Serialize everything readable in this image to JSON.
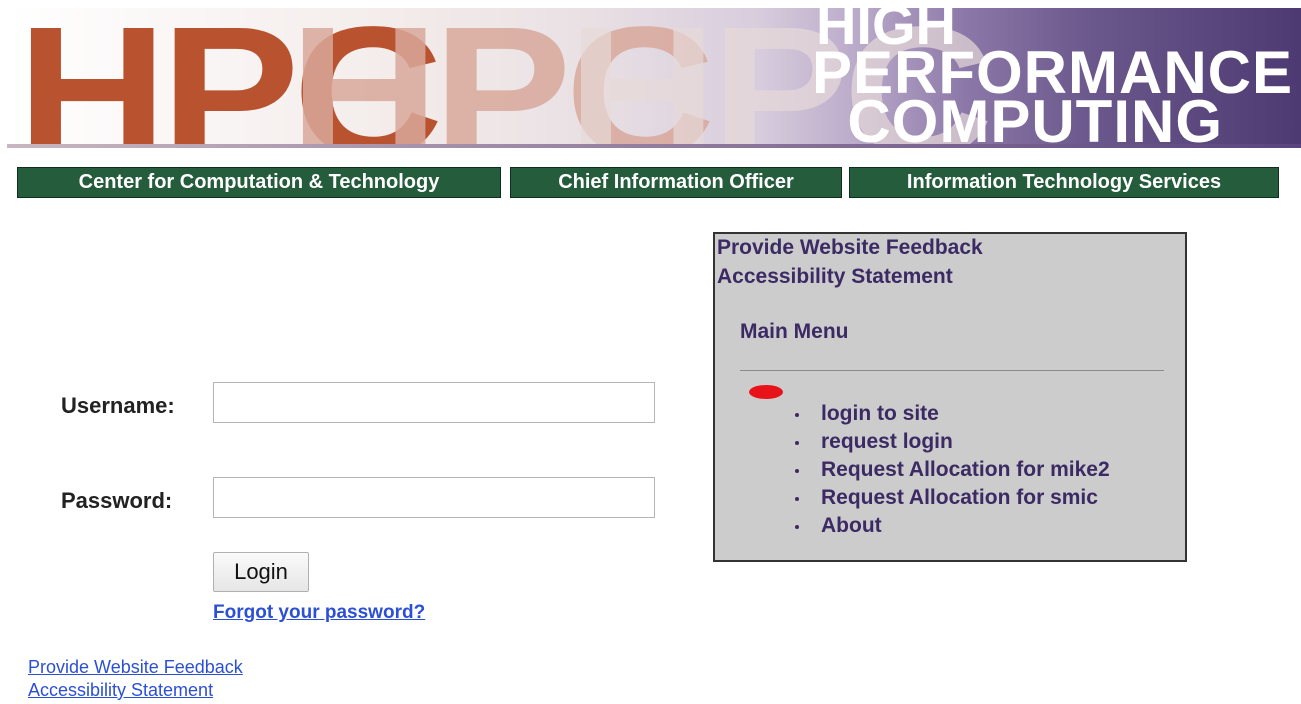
{
  "banner": {
    "logo_letters": "HPC",
    "title_line1": "HIGH",
    "title_line2": "PERFORMANCE",
    "title_line3": "COMPUTING"
  },
  "nav": {
    "items": [
      {
        "label": "Center for Computation & Technology"
      },
      {
        "label": "Chief Information Officer"
      },
      {
        "label": "Information Technology Services"
      }
    ]
  },
  "login": {
    "username_label": "Username:",
    "username_value": "",
    "password_label": "Password:",
    "password_value": "",
    "login_button": "Login",
    "forgot_link": "Forgot your password?"
  },
  "panel": {
    "feedback_link": "Provide Website Feedback",
    "accessibility_link": "Accessibility Statement",
    "menu_title": "Main Menu",
    "menu_items": [
      {
        "label": "login to site"
      },
      {
        "label": "request login"
      },
      {
        "label": "Request Allocation for mike2"
      },
      {
        "label": "Request Allocation for smic"
      },
      {
        "label": "About"
      }
    ]
  },
  "footer": {
    "feedback_link": "Provide Website Feedback",
    "accessibility_link": "Accessibility Statement"
  },
  "colors": {
    "nav_bg": "#245c3c",
    "panel_bg": "#cccccc",
    "panel_text": "#3b2a63",
    "link": "#2b4fd6",
    "hpc_red": "#b9522f",
    "mark_red": "#e8121b"
  }
}
